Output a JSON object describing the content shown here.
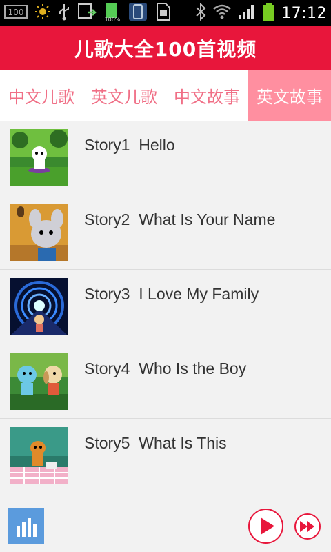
{
  "status_bar": {
    "time": "17:12",
    "battery_percent_label": "100%",
    "icons": [
      "sim-100-icon",
      "sun-icon",
      "usb-icon",
      "screen-sync-icon",
      "battery-charge-icon",
      "phone-icon",
      "sd-card-icon",
      "bluetooth-icon",
      "wifi-icon",
      "signal-icon",
      "battery-icon"
    ]
  },
  "header": {
    "title": "儿歌大全100首视频"
  },
  "tabs": [
    {
      "label": "中文儿歌",
      "active": false
    },
    {
      "label": "英文儿歌",
      "active": false
    },
    {
      "label": "中文故事",
      "active": false
    },
    {
      "label": "英文故事",
      "active": true
    }
  ],
  "stories": [
    {
      "title": "Story1  Hello"
    },
    {
      "title": "Story2  What Is Your Name"
    },
    {
      "title": "Story3  I Love My Family"
    },
    {
      "title": "Story4  Who Is the Boy"
    },
    {
      "title": "Story5  What Is This"
    }
  ],
  "player": {
    "icons": [
      "equalizer-icon",
      "play-icon",
      "fast-forward-icon"
    ]
  },
  "colors": {
    "header_bg": "#e8163b",
    "tab_text": "#f06f86",
    "tab_active_bg": "#ff8fa0",
    "player_accent": "#e8163b",
    "equalizer_bg": "#5b9bdd"
  }
}
